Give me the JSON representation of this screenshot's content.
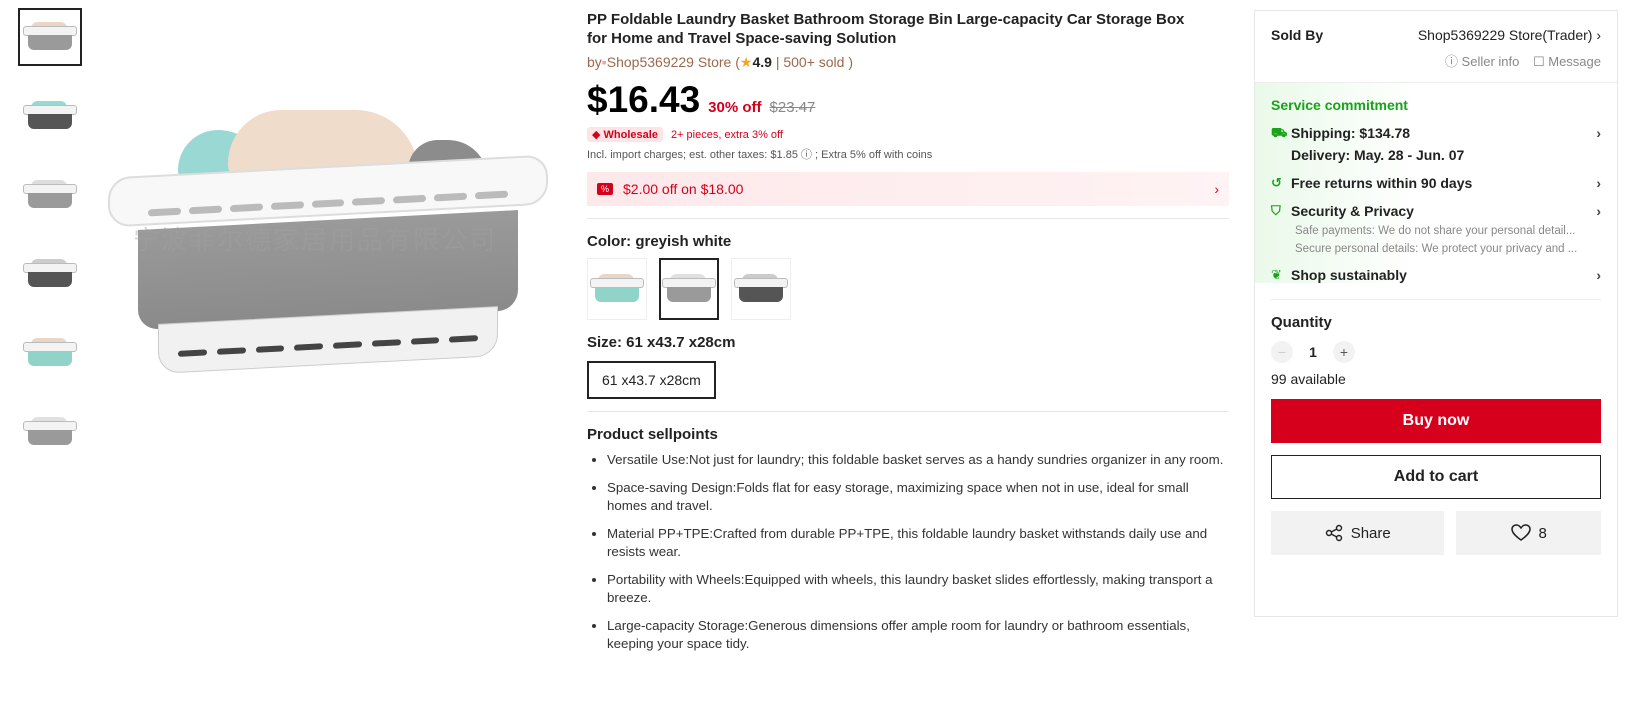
{
  "product": {
    "title": "PP Foldable Laundry Basket Bathroom Storage Bin Large-capacity Car Storage Box for Home and Travel Space-saving Solution",
    "by_prefix": "by",
    "store_name": "Shop5369229 Store",
    "rating_open": "(",
    "rating": "4.9",
    "sold_text": "| 500+ sold )",
    "price": "$16.43",
    "discount_pct": "30% off",
    "original_price": "$23.47",
    "wholesale_badge": "Wholesale",
    "wholesale_text": "2+ pieces, extra 3% off",
    "tax_line": "Incl. import charges; est. other taxes: $1.85 ⓘ ; Extra 5% off with coins",
    "coupon_icon": "%",
    "coupon_text": "$2.00 off on $18.00",
    "watermark": "宁波菲尔德家居用品有限公司"
  },
  "color": {
    "label": "Color: greyish white",
    "swatches": [
      {
        "name": "teal",
        "color": "#8fd3c9"
      },
      {
        "name": "greyish white",
        "color": "#9a9a9a"
      },
      {
        "name": "dark grey",
        "color": "#555555"
      }
    ]
  },
  "size": {
    "label": "Size: 61 x43.7 x28cm",
    "option": "61 x43.7 x28cm"
  },
  "sellpoints": {
    "title": "Product sellpoints",
    "items": [
      "Versatile Use:Not just for laundry; this foldable basket serves as a handy sundries organizer in any room.",
      "Space-saving Design:Folds flat for easy storage, maximizing space when not in use, ideal for small homes and travel.",
      "Material  PP+TPE:Crafted from durable PP+TPE, this foldable laundry basket withstands daily use and resists wear.",
      "Portability with Wheels:Equipped with wheels, this laundry basket slides effortlessly, making transport a breeze.",
      "Large-capacity Storage:Generous dimensions offer ample room for laundry or bathroom essentials, keeping your space tidy."
    ]
  },
  "seller": {
    "sold_by_label": "Sold By",
    "store": "Shop5369229 Store(Trader)",
    "seller_info": "ⓘ Seller info",
    "message": "☐ Message"
  },
  "service": {
    "title": "Service commitment",
    "shipping": "Shipping: $134.78",
    "delivery": "Delivery: May. 28 - Jun. 07",
    "returns": "Free returns within 90 days",
    "security": "Security & Privacy",
    "security_sub1": "Safe payments: We do not share your personal detail...",
    "security_sub2": "Secure personal details: We protect your privacy and ...",
    "sustainable": "Shop sustainably"
  },
  "quantity": {
    "title": "Quantity",
    "value": "1",
    "available": "99 available"
  },
  "actions": {
    "buy_now": "Buy now",
    "add_to_cart": "Add to cart",
    "share": "Share",
    "likes": "8"
  },
  "thumbnails": [
    {
      "body_color": "#9a9a9a",
      "cloth": "#e9d6c6"
    },
    {
      "body_color": "#555555",
      "cloth": "#9ad8d4"
    },
    {
      "body_color": "#9a9a9a",
      "cloth": "#dddddd"
    },
    {
      "body_color": "#555555",
      "cloth": "#cccccc"
    },
    {
      "body_color": "#8fd3c9",
      "cloth": "#e9d6c6"
    },
    {
      "body_color": "#9a9a9a",
      "cloth": "#e0e0e0"
    }
  ]
}
